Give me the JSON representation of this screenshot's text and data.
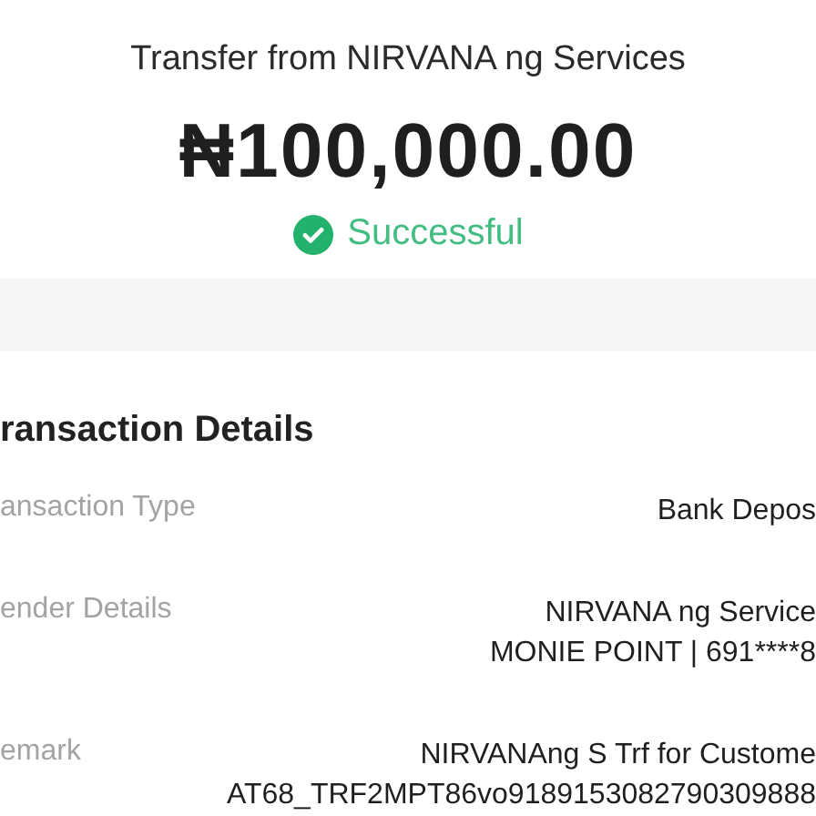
{
  "header": {
    "title": "Transfer from NIRVANA ng Services",
    "amount": "₦100,000.00",
    "status": {
      "label": "Successful",
      "kind": "success"
    }
  },
  "details": {
    "heading": "ransaction Details",
    "rows": [
      {
        "label": "ansaction Type",
        "values": [
          "Bank Depos"
        ]
      },
      {
        "label": "ender Details",
        "values": [
          "NIRVANA ng Service",
          "MONIE POINT | 691****8"
        ]
      },
      {
        "label": "emark",
        "values": [
          "NIRVANAng S Trf for Custome",
          "AT68_TRF2MPT86vo9189153082790309888"
        ]
      }
    ]
  }
}
